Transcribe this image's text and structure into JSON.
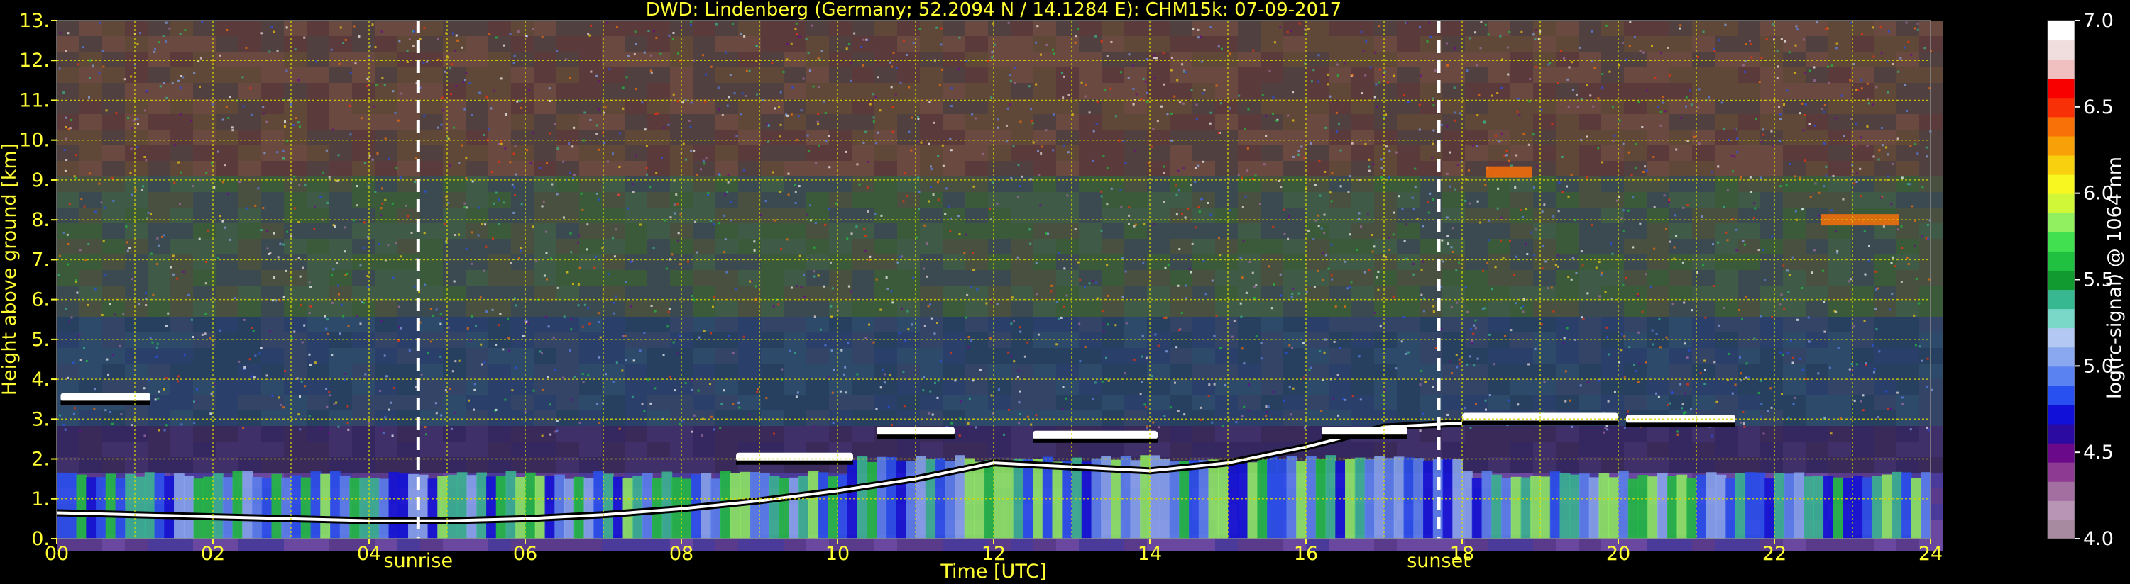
{
  "chart_data": {
    "type": "heatmap",
    "title": "DWD: Lindenberg (Germany; 52.2094 N / 14.1284 E):    CHM15k: 07-09-2017",
    "xlabel": "Time [UTC]",
    "ylabel": "Height above ground [km]",
    "x_ticks": [
      "00",
      "02",
      "04",
      "06",
      "08",
      "10",
      "12",
      "14",
      "16",
      "18",
      "20",
      "22",
      "24"
    ],
    "y_ticks": [
      "0.",
      "1.",
      "2.",
      "3.",
      "4.",
      "5.",
      "6.",
      "7.",
      "8.",
      "9.",
      "10.",
      "11.",
      "12.",
      "13."
    ],
    "xlim": [
      0,
      24
    ],
    "ylim": [
      0,
      13
    ],
    "grid": true,
    "markers": [
      {
        "label": "sunrise",
        "x": 4.63
      },
      {
        "label": "sunset",
        "x": 17.7
      }
    ],
    "colorbar": {
      "label": "log(rc-signal) @ 1064 nm",
      "ticks": [
        "4.0",
        "4.5",
        "5.0",
        "5.5",
        "6.0",
        "6.5",
        "7.0"
      ],
      "range": [
        4.0,
        7.0
      ],
      "colors": [
        "#a88aa0",
        "#b895b5",
        "#a36ea0",
        "#8d3a93",
        "#6a0a8a",
        "#2a0aa0",
        "#1010d8",
        "#2850f0",
        "#5a82f0",
        "#8aa8f0",
        "#b4c8f4",
        "#7ad8c8",
        "#38b890",
        "#109a30",
        "#20c040",
        "#40e050",
        "#90f060",
        "#d0f838",
        "#f8f820",
        "#f8d010",
        "#f8a008",
        "#f87008",
        "#f83008",
        "#f80000",
        "#f0c0c0",
        "#f0dede",
        "#ffffff"
      ]
    },
    "layers": [
      {
        "name": "boundary_layer_top",
        "x": [
          0,
          1,
          2,
          3,
          4,
          4.63,
          5,
          6,
          7,
          8,
          9,
          10,
          11,
          12,
          13,
          14,
          15,
          16,
          17,
          18
        ],
        "y_km": [
          0.65,
          0.6,
          0.55,
          0.5,
          0.45,
          0.45,
          0.45,
          0.5,
          0.6,
          0.75,
          0.95,
          1.2,
          1.5,
          1.9,
          1.8,
          1.7,
          1.9,
          2.3,
          2.8,
          2.9
        ]
      },
      {
        "name": "cloud_layer",
        "segments": [
          [
            0.05,
            1.2,
            3.55
          ],
          [
            8.7,
            10.2,
            2.05
          ],
          [
            10.5,
            11.5,
            2.7
          ],
          [
            12.5,
            14.1,
            2.6
          ],
          [
            16.2,
            17.3,
            2.7
          ],
          [
            18,
            20,
            3.05
          ],
          [
            20.1,
            21.5,
            3.0
          ]
        ]
      },
      {
        "name": "cirrus",
        "segments": [
          [
            18.3,
            18.9,
            9.2
          ],
          [
            22.6,
            23.6,
            8.0
          ]
        ]
      }
    ]
  }
}
